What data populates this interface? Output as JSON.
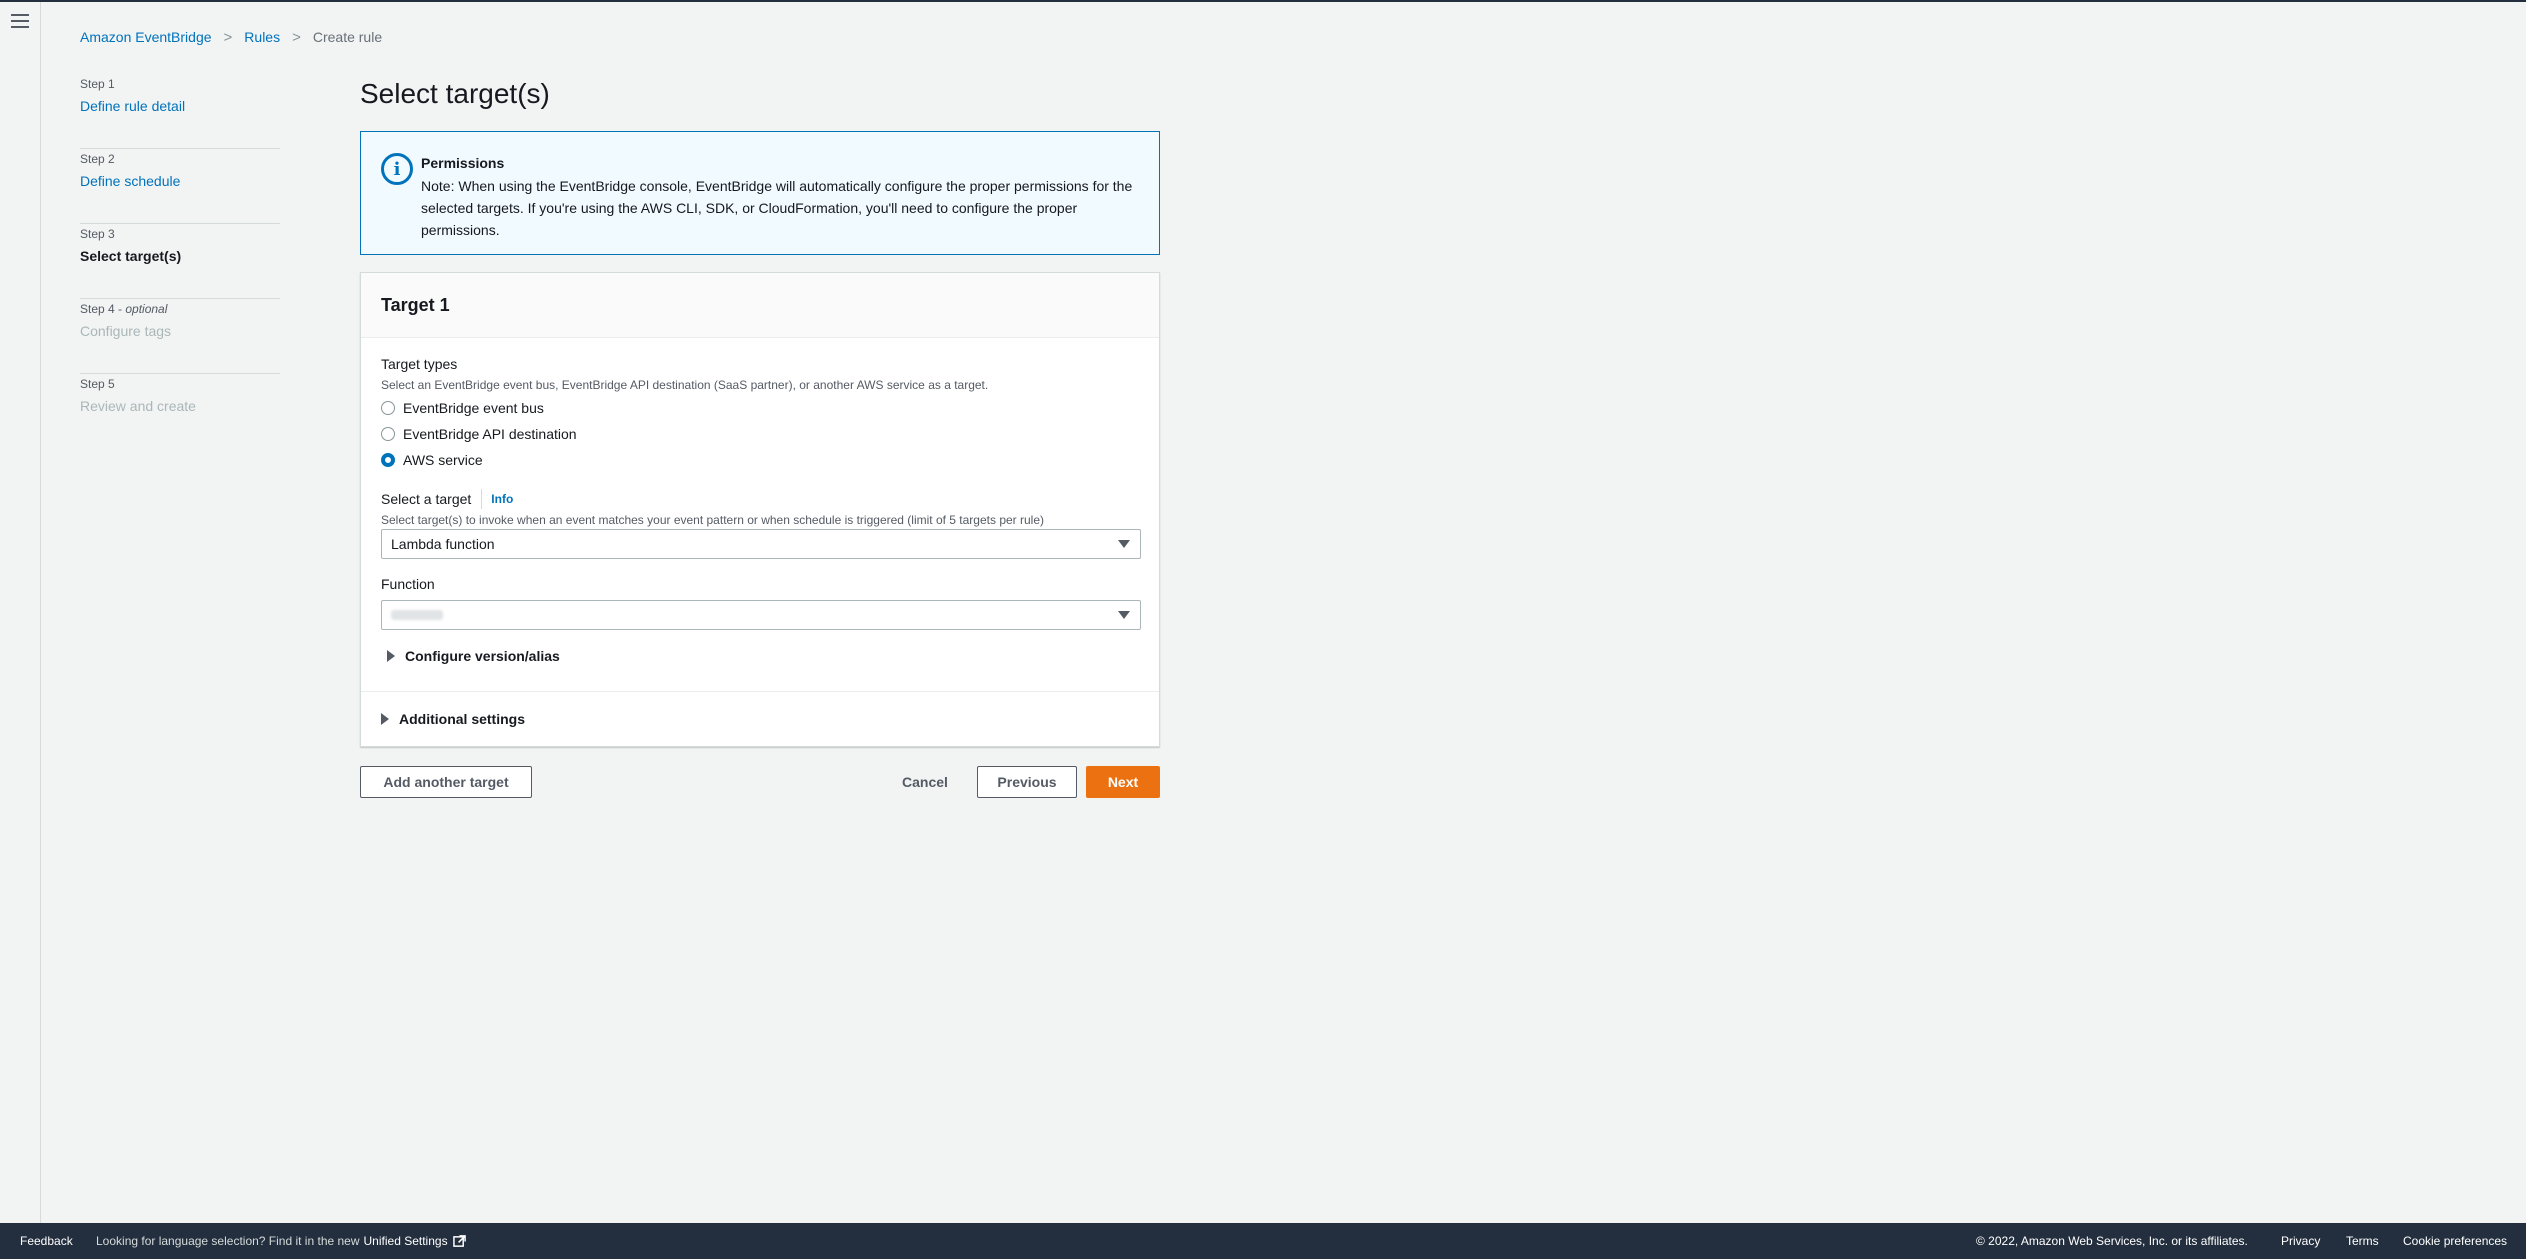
{
  "breadcrumb": {
    "items": [
      "Amazon EventBridge",
      "Rules"
    ],
    "current": "Create rule"
  },
  "steps": [
    {
      "num": "Step 1",
      "label": "Define rule detail",
      "state": "link"
    },
    {
      "num": "Step 2",
      "label": "Define schedule",
      "state": "link"
    },
    {
      "num": "Step 3",
      "label": "Select target(s)",
      "state": "active"
    },
    {
      "num": "Step 4 - ",
      "optional": "optional",
      "label": "Configure tags",
      "state": "disabled"
    },
    {
      "num": "Step 5",
      "label": "Review and create",
      "state": "disabled"
    }
  ],
  "page_title": "Select target(s)",
  "alert": {
    "icon": "info-circle-icon",
    "title": "Permissions",
    "body": "Note: When using the EventBridge console, EventBridge will automatically configure the proper permissions for the selected targets. If you're using the AWS CLI, SDK, or CloudFormation, you'll need to configure the proper permissions."
  },
  "target": {
    "title": "Target 1",
    "types_label": "Target types",
    "types_desc": "Select an EventBridge event bus, EventBridge API destination (SaaS partner), or another AWS service as a target.",
    "options": [
      {
        "label": "EventBridge event bus",
        "checked": false
      },
      {
        "label": "EventBridge API destination",
        "checked": false
      },
      {
        "label": "AWS service",
        "checked": true
      }
    ],
    "select_label": "Select a target",
    "info_link": "Info",
    "select_desc": "Select target(s) to invoke when an event matches your event pattern or when schedule is triggered (limit of 5 targets per rule)",
    "select_value": "Lambda function",
    "function_label": "Function",
    "configure_version": "Configure version/alias",
    "additional_settings": "Additional settings"
  },
  "buttons": {
    "add_target": "Add another target",
    "cancel": "Cancel",
    "previous": "Previous",
    "next": "Next"
  },
  "footer": {
    "feedback": "Feedback",
    "lang_msg": "Looking for language selection? Find it in the new",
    "unified_settings": "Unified Settings",
    "copyright": "© 2022, Amazon Web Services, Inc. or its affiliates.",
    "privacy": "Privacy",
    "terms": "Terms",
    "cookie": "Cookie preferences"
  },
  "colors": {
    "link": "#0073bb",
    "primary": "#ec7211",
    "footer_bg": "#232f3e",
    "alert_bg": "#f1faff"
  }
}
